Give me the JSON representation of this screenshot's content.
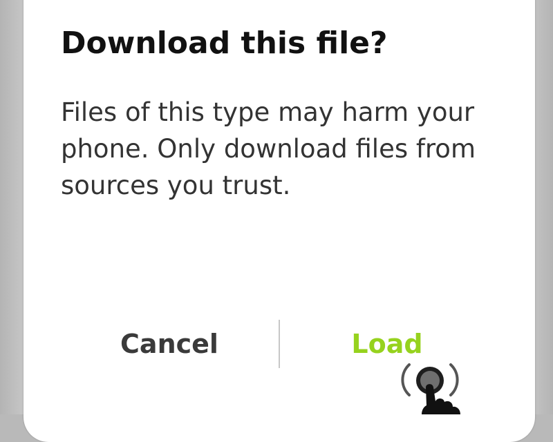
{
  "dialog": {
    "title": "Download this file?",
    "message": "Files of this type may harm your phone. Only download files from sources you trust.",
    "cancel_label": "Cancel",
    "confirm_label": "Load"
  },
  "colors": {
    "confirm_accent": "#96d21e",
    "title_text": "#111111",
    "body_text": "#333333",
    "backdrop": "#c6c6c6"
  },
  "icons": {
    "tap_gesture": "tap-gesture-icon"
  }
}
